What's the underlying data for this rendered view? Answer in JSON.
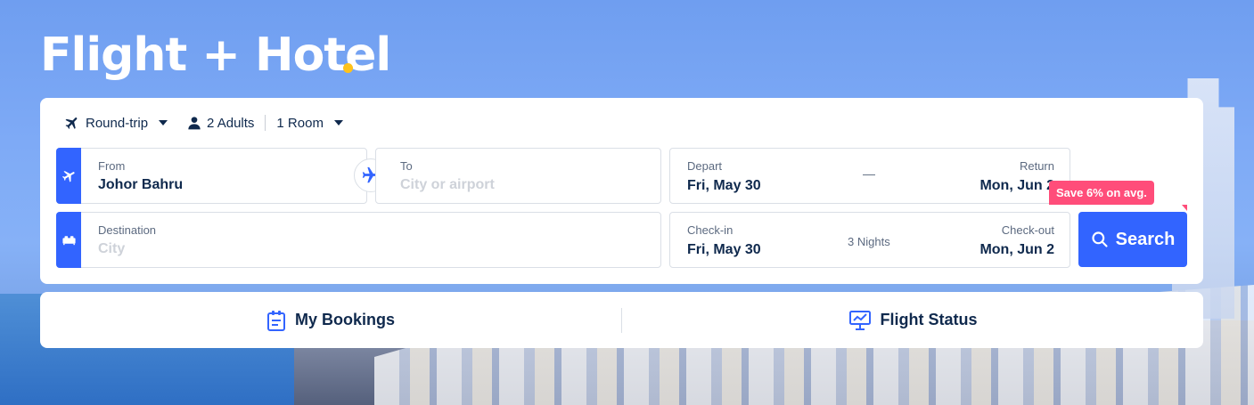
{
  "hero": {
    "title": "Flight + Hotel"
  },
  "options": {
    "trip_type": "Round-trip",
    "adults": "2 Adults",
    "rooms": "1 Room"
  },
  "flight": {
    "from_label": "From",
    "from_value": "Johor Bahru",
    "to_label": "To",
    "to_placeholder": "City or airport",
    "depart_label": "Depart",
    "depart_value": "Fri, May 30",
    "date_separator": "—",
    "return_label": "Return",
    "return_value": "Mon, Jun 2"
  },
  "hotel": {
    "destination_label": "Destination",
    "destination_placeholder": "City",
    "checkin_label": "Check-in",
    "checkin_value": "Fri, May 30",
    "nights": "3 Nights",
    "checkout_label": "Check-out",
    "checkout_value": "Mon, Jun 2"
  },
  "search": {
    "label": "Search",
    "badge": "Save 6% on avg."
  },
  "bottom_bar": {
    "bookings": "My Bookings",
    "flight_status": "Flight Status"
  },
  "colors": {
    "accent": "#3264ff",
    "badge": "#ff4d7a",
    "title_dot": "#ffc21a",
    "text_dark": "#0f294d"
  },
  "icons": {
    "trip_type": "plane-icon",
    "travellers": "person-icon",
    "from": "plane-takeoff-icon",
    "swap": "plane-swap-icon",
    "destination": "bed-icon",
    "search": "search-icon",
    "bookings": "clipboard-icon",
    "flight_status": "monitor-chart-icon"
  }
}
